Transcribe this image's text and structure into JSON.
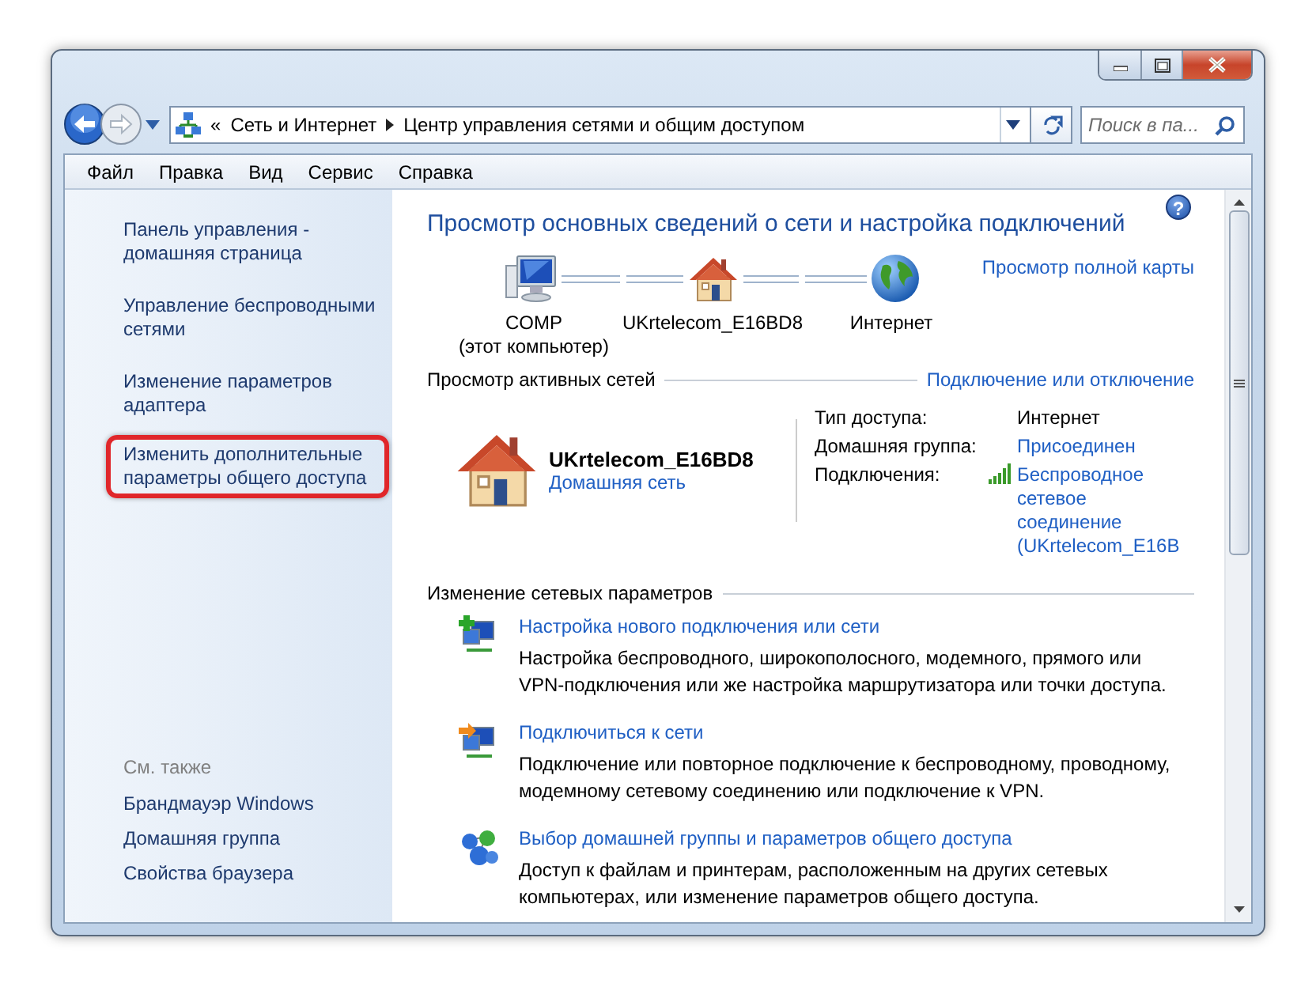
{
  "address_bar": {
    "overflow_mark": "«",
    "path": [
      "Сеть и Интернет",
      "Центр управления сетями и общим доступом"
    ]
  },
  "search": {
    "placeholder": "Поиск в па..."
  },
  "menu": [
    "Файл",
    "Правка",
    "Вид",
    "Сервис",
    "Справка"
  ],
  "sidebar": {
    "items": [
      {
        "label": "Панель управления - домашняя страница",
        "highlighted": false
      },
      {
        "label": "Управление беспроводными сетями",
        "highlighted": false
      },
      {
        "label": "Изменение параметров адаптера",
        "highlighted": false
      },
      {
        "label": "Изменить дополнительные параметры общего доступа",
        "highlighted": true
      }
    ],
    "see_also": {
      "heading": "См. также",
      "items": [
        "Брандмауэр Windows",
        "Домашняя группа",
        "Свойства браузера"
      ]
    }
  },
  "main": {
    "help": "?",
    "title": "Просмотр основных сведений о сети и настройка подключений",
    "map": {
      "nodes": [
        {
          "kind": "computer",
          "label": "COMP",
          "sublabel": "(этот компьютер)"
        },
        {
          "kind": "house",
          "label": "UKrtelecom_E16BD8"
        },
        {
          "kind": "globe",
          "label": "Интернет"
        }
      ],
      "full_map_link": "Просмотр полной карты"
    },
    "active_networks": {
      "heading": "Просмотр активных сетей",
      "link": "Подключение или отключение",
      "network": {
        "name": "UKrtelecom_E16BD8",
        "type": "Домашняя сеть"
      },
      "properties": [
        {
          "label": "Тип доступа:",
          "value": "Интернет",
          "kind": "text"
        },
        {
          "label": "Домашняя группа:",
          "value": "Присоединен",
          "kind": "link"
        },
        {
          "label": "Подключения:",
          "value": "Беспроводное сетевое соединение (UKrtelecom_E16B",
          "kind": "wireless"
        }
      ]
    },
    "change_settings": {
      "heading": "Изменение сетевых параметров",
      "tasks": [
        {
          "kind": "new-connection",
          "title": "Настройка нового подключения или сети",
          "description": "Настройка беспроводного, широкополосного, модемного, прямого или VPN-подключения или же настройка маршрутизатора или точки доступа."
        },
        {
          "kind": "connect",
          "title": "Подключиться к сети",
          "description": "Подключение или повторное подключение к беспроводному, проводному, модемному сетевому соединению или подключение к VPN."
        },
        {
          "kind": "homegroup",
          "title": "Выбор домашней группы и параметров общего доступа",
          "description": "Доступ к файлам и принтерам, расположенным на других сетевых компьютерах, или изменение параметров общего доступа."
        }
      ]
    }
  }
}
